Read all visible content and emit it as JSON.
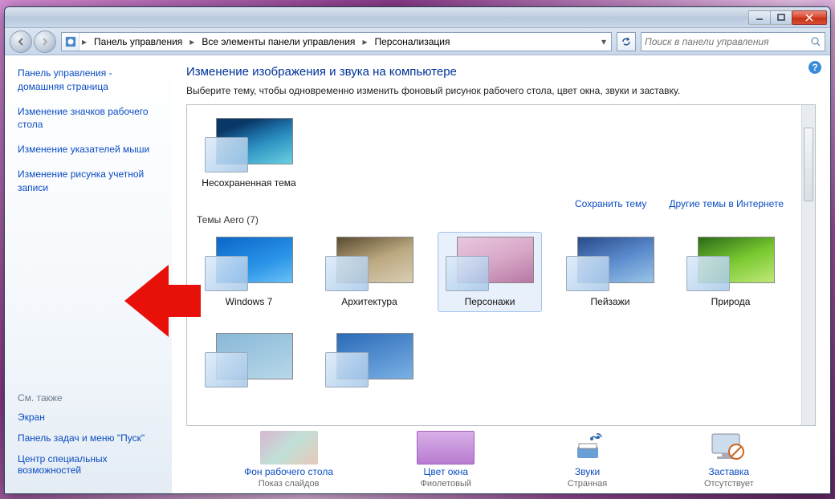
{
  "breadcrumb": {
    "items": [
      "Панель управления",
      "Все элементы панели управления",
      "Персонализация"
    ]
  },
  "search": {
    "placeholder": "Поиск в панели управления"
  },
  "sidebar": {
    "links": [
      "Панель управления - домашняя страница",
      "Изменение значков рабочего стола",
      "Изменение указателей мыши",
      "Изменение рисунка учетной записи"
    ],
    "see_also_label": "См. также",
    "secondary": [
      "Экран",
      "Панель задач и меню \"Пуск\"",
      "Центр специальных возможностей"
    ]
  },
  "main": {
    "title": "Изменение изображения и звука на компьютере",
    "subtitle": "Выберите тему, чтобы одновременно изменить фоновый рисунок рабочего стола, цвет окна, звуки и заставку.",
    "unsaved_theme": "Несохраненная тема",
    "save_theme": "Сохранить тему",
    "more_themes": "Другие темы в Интернете",
    "aero_section": "Темы Aero (7)",
    "themes": [
      "Windows 7",
      "Архитектура",
      "Персонажи",
      "Пейзажи",
      "Природа"
    ]
  },
  "bottom": {
    "items": [
      {
        "label": "Фон рабочего стола",
        "value": "Показ слайдов"
      },
      {
        "label": "Цвет окна",
        "value": "Фиолетовый"
      },
      {
        "label": "Звуки",
        "value": "Странная"
      },
      {
        "label": "Заставка",
        "value": "Отсутствует"
      }
    ]
  },
  "theme_colors": {
    "unsaved": "linear-gradient(160deg,#0a3866 20%,#1a6aa0 40%,#3094c4 60%,#6ad0e0)",
    "win7": "linear-gradient(160deg,#0a66c8,#2a94e8 60%,#6ac0f4)",
    "arch": "linear-gradient(160deg,#5a4a30,#bba880 50%,#d8cdb4)",
    "chars": "linear-gradient(160deg,#e8c8e0,#d8a8c8 50%,#b878a4)",
    "land": "linear-gradient(160deg,#284a88,#5a8acc 50%,#9ac4e8)",
    "nature": "linear-gradient(160deg,#2a6a18,#78c830 50%,#c0e878)",
    "extra1": "linear-gradient(160deg,#88b8d8,#b8d8e8)",
    "extra2": "linear-gradient(160deg,#2a6ab8,#7ab0e4)"
  }
}
